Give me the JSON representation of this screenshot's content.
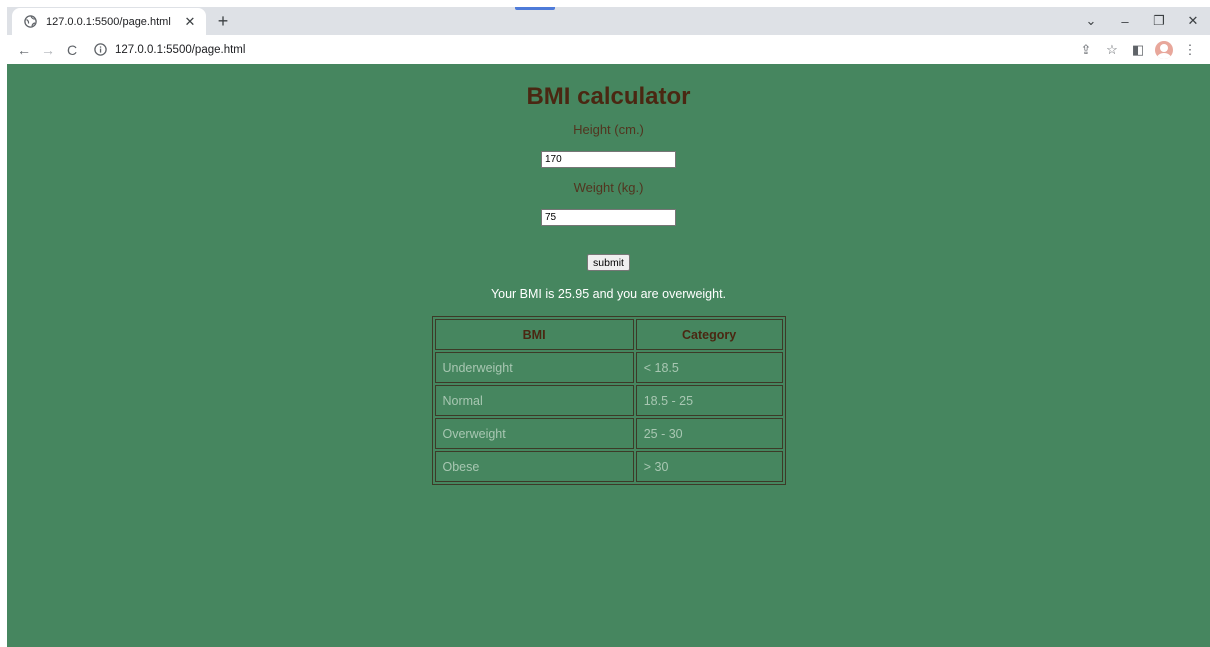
{
  "browser": {
    "tab_title": "127.0.0.1:5500/page.html",
    "tab_close": "✕",
    "new_tab": "+",
    "url": "127.0.0.1:5500/page.html",
    "nav": {
      "back": "←",
      "forward": "→",
      "reload": "C"
    },
    "window_controls": {
      "tab_search": "⌄",
      "minimize": "–",
      "restore": "❐",
      "close": "✕"
    },
    "toolbar_icons": {
      "share": "⇪",
      "bookmark": "☆",
      "side_panel": "◧",
      "menu": "⋮"
    }
  },
  "page": {
    "title": "BMI calculator",
    "height_label": "Height (cm.)",
    "height_value": "170",
    "weight_label": "Weight (kg.)",
    "weight_value": "75",
    "submit_label": "submit",
    "result_text": "Your BMI is 25.95 and you are overweight."
  },
  "table": {
    "headers": [
      "BMI",
      "Category"
    ],
    "rows": [
      [
        "Underweight",
        "< 18.5"
      ],
      [
        "Normal",
        "18.5 - 25"
      ],
      [
        "Overweight",
        "25 - 30"
      ],
      [
        "Obese",
        "> 30"
      ]
    ]
  },
  "colors": {
    "page_background": "#46865f",
    "title": "#4a2712",
    "result_text": "#ffffff",
    "table_cell_text": "#a8c7b2"
  }
}
